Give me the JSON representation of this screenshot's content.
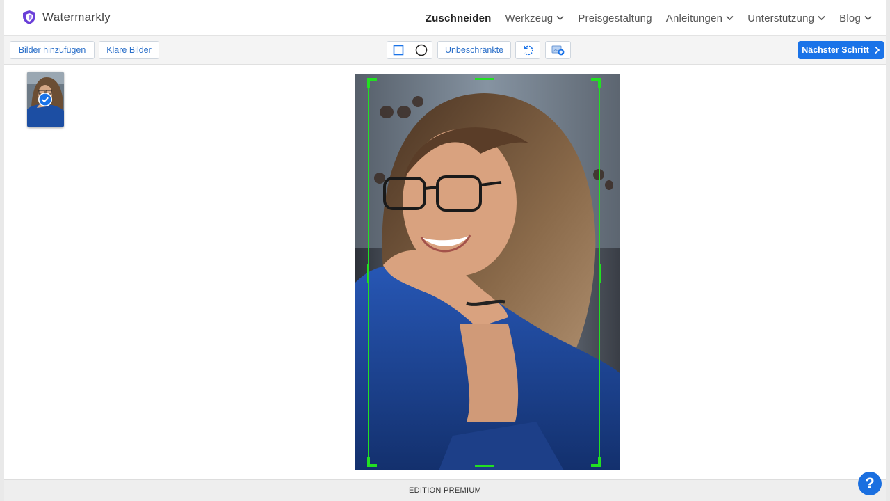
{
  "brand": {
    "name": "Watermarkly",
    "color": "#6a3fd8"
  },
  "nav": {
    "crop": "Zuschneiden",
    "tool": "Werkzeug",
    "pricing": "Preisgestaltung",
    "guides": "Anleitungen",
    "support": "Unterstützung",
    "blog": "Blog"
  },
  "toolbar": {
    "add_images": "Bilder hinzufügen",
    "clear_images": "Klare Bilder",
    "aspect": "Unbeschränkte",
    "next": "Nächster Schritt",
    "shape_icons": [
      "square-icon",
      "circle-icon"
    ],
    "rotate_icon": "rotate-icon",
    "add_image_icon": "image-add-icon"
  },
  "footer": {
    "edition": "EDITION PREMIUM"
  },
  "help": {
    "label": "?"
  },
  "colors": {
    "accent": "#1a73e8",
    "crop_frame": "#22e022"
  }
}
